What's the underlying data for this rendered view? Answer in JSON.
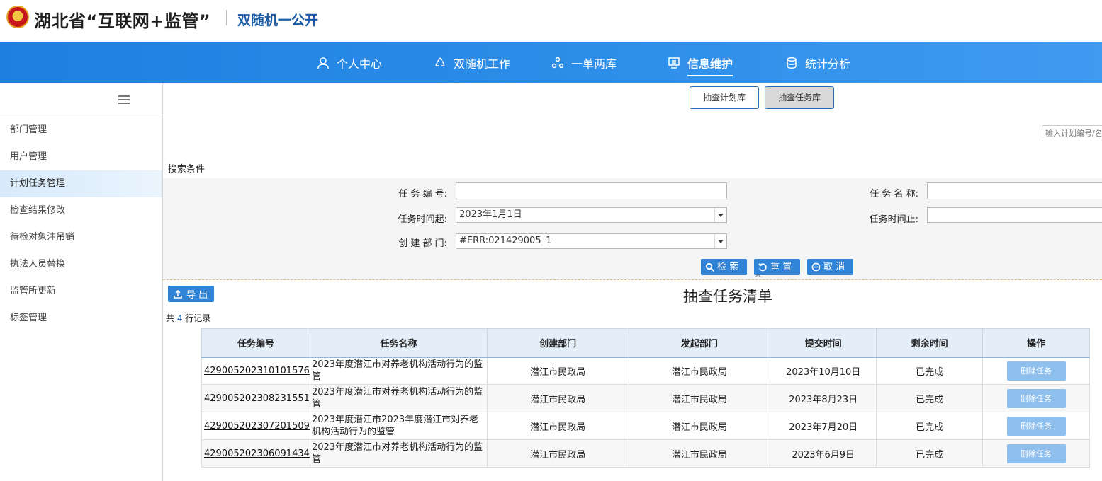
{
  "header": {
    "site_title": "湖北省“互联网+监管”",
    "subtitle": "双随机一公开"
  },
  "nav": {
    "items": [
      {
        "label": "个人中心",
        "icon": "user-icon"
      },
      {
        "label": "双随机工作",
        "icon": "recycle-icon"
      },
      {
        "label": "一单两库",
        "icon": "nodes-icon"
      },
      {
        "label": "信息维护",
        "icon": "monitor-icon",
        "active": true
      },
      {
        "label": "统计分析",
        "icon": "database-icon"
      }
    ]
  },
  "sidebar": {
    "items": [
      {
        "label": "部门管理"
      },
      {
        "label": "用户管理"
      },
      {
        "label": "计划任务管理",
        "active": true
      },
      {
        "label": "检查结果修改"
      },
      {
        "label": "待检对象注吊销"
      },
      {
        "label": "执法人员替换"
      },
      {
        "label": "监管所更新"
      },
      {
        "label": "标签管理"
      }
    ]
  },
  "tabs": {
    "plan_library": "抽查计划库",
    "task_library": "抽查任务库"
  },
  "top_search": {
    "placeholder": "输入计划编号/名"
  },
  "search": {
    "title": "搜索条件",
    "task_id_label": "任 务 编 号:",
    "task_id_value": "",
    "task_name_label": "任 务 名 称:",
    "task_name_value": "",
    "time_start_label": "任务时间起:",
    "time_start_value": "2023年1月1日",
    "time_end_label": "任务时间止:",
    "time_end_value": "",
    "dept_label": "创 建 部 门:",
    "dept_value": "#ERR:021429005_1",
    "search_btn": "检 索",
    "reset_btn": "重 置",
    "cancel_btn": "取 消"
  },
  "list": {
    "export_btn": "导 出",
    "title": "抽查任务清单",
    "count_prefix": "共 ",
    "count": "4",
    "count_suffix": " 行记录"
  },
  "table": {
    "headers": [
      "任务编号",
      "任务名称",
      "创建部门",
      "发起部门",
      "提交时间",
      "剩余时间",
      "操作"
    ],
    "rows": [
      {
        "id": "429005202310101576",
        "name": "2023年度潜江市对养老机构活动行为的监管",
        "create_dept": "潜江市民政局",
        "init_dept": "潜江市民政局",
        "submit_time": "2023年10月10日",
        "remaining": "已完成",
        "action": "删除任务"
      },
      {
        "id": "429005202308231551",
        "name": "2023年度潜江市对养老机构活动行为的监管",
        "create_dept": "潜江市民政局",
        "init_dept": "潜江市民政局",
        "submit_time": "2023年8月23日",
        "remaining": "已完成",
        "action": "删除任务"
      },
      {
        "id": "429005202307201509",
        "name": "2023年度潜江市2023年度潜江市对养老机构活动行为的监管",
        "create_dept": "潜江市民政局",
        "init_dept": "潜江市民政局",
        "submit_time": "2023年7月20日",
        "remaining": "已完成",
        "action": "删除任务"
      },
      {
        "id": "429005202306091434",
        "name": "2023年度潜江市对养老机构活动行为的监管",
        "create_dept": "潜江市民政局",
        "init_dept": "潜江市民政局",
        "submit_time": "2023年6月9日",
        "remaining": "已完成",
        "action": "删除任务"
      }
    ]
  }
}
